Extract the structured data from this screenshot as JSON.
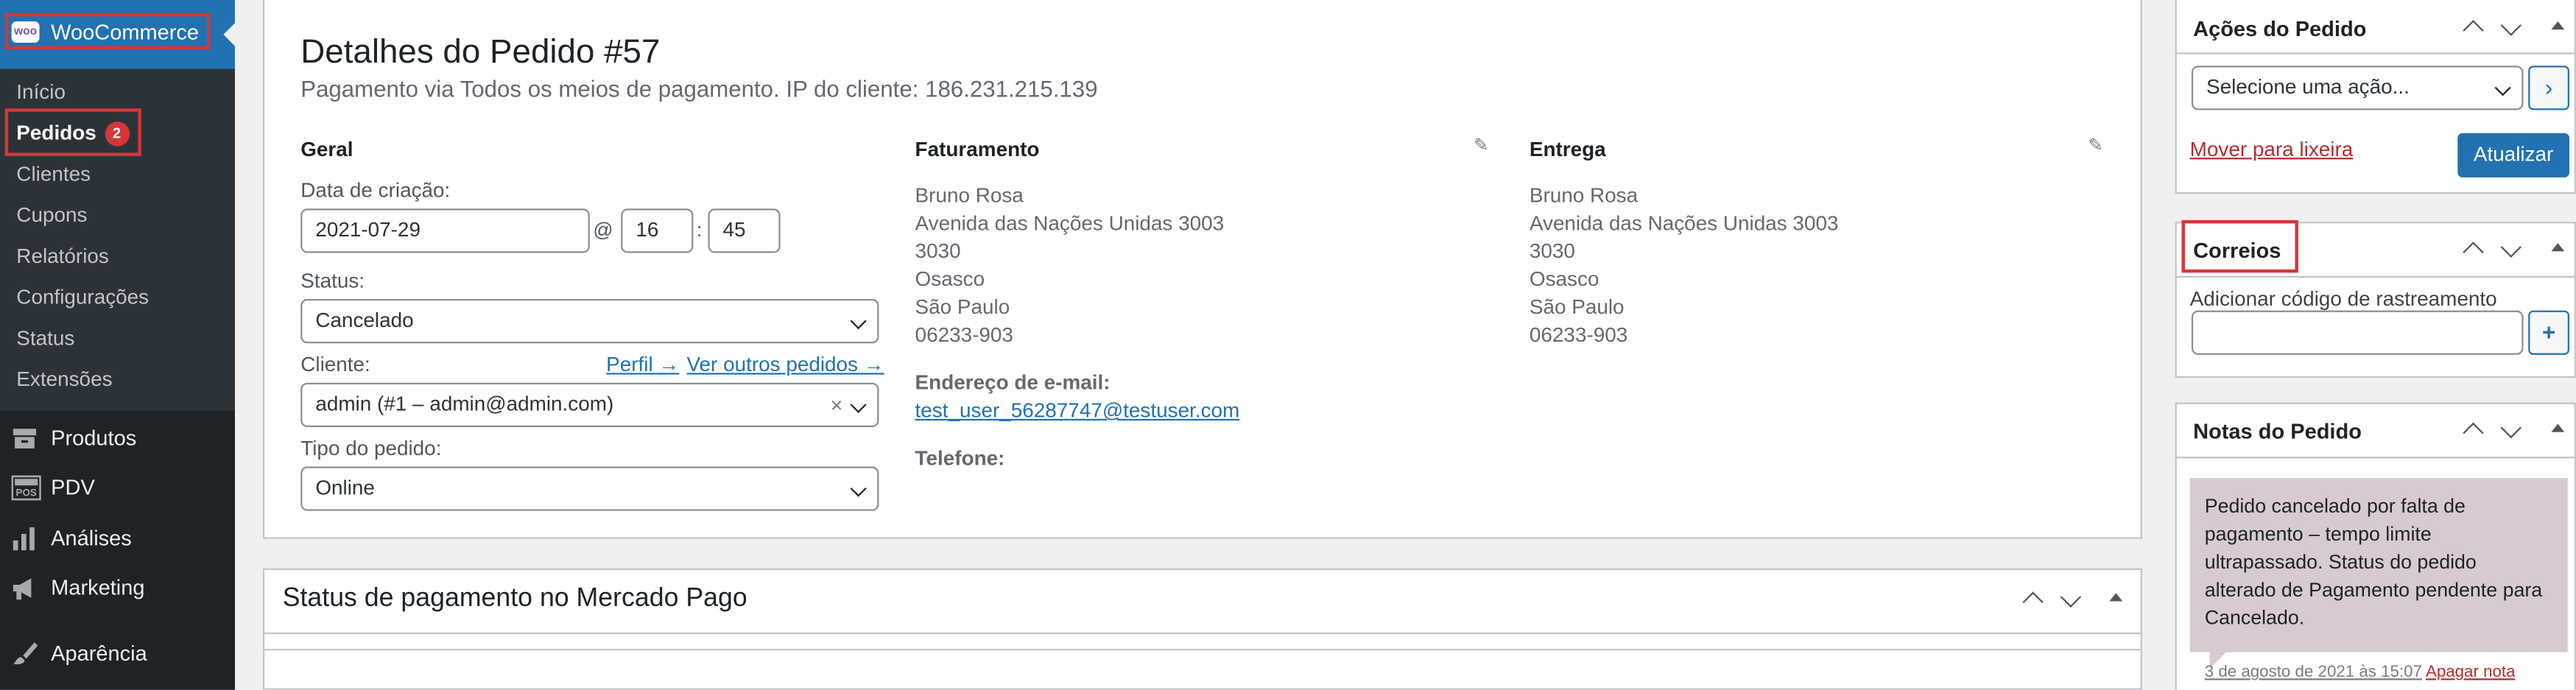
{
  "sidebar": {
    "brand": "WooCommerce",
    "logo_text": "woo",
    "submenu": [
      {
        "label": "Início"
      },
      {
        "label": "Pedidos",
        "badge": "2"
      },
      {
        "label": "Clientes"
      },
      {
        "label": "Cupons"
      },
      {
        "label": "Relatórios"
      },
      {
        "label": "Configurações"
      },
      {
        "label": "Status"
      },
      {
        "label": "Extensões"
      }
    ],
    "menu": [
      {
        "label": "Produtos",
        "icon": "archive-icon"
      },
      {
        "label": "PDV",
        "icon": "pos-icon"
      },
      {
        "label": "Análises",
        "icon": "bar-chart-icon"
      },
      {
        "label": "Marketing",
        "icon": "megaphone-icon"
      },
      {
        "label": "Aparência",
        "icon": "paintbrush-icon"
      }
    ]
  },
  "order": {
    "title": "Detalhes do Pedido #57",
    "subtitle": "Pagamento via Todos os meios de pagamento. IP do cliente: 186.231.215.139",
    "general": {
      "heading": "Geral",
      "date_label": "Data de criação:",
      "date": "2021-07-29",
      "at": "@",
      "hour": "16",
      "colon": ":",
      "minute": "45",
      "status_label": "Status:",
      "status": "Cancelado",
      "customer_label": "Cliente:",
      "profile_link": "Perfil →",
      "other_orders_link": "Ver outros pedidos →",
      "customer": "admin (#1 – admin@admin.com)",
      "clear": "×",
      "type_label": "Tipo do pedido:",
      "type": "Online"
    },
    "billing": {
      "heading": "Faturamento",
      "lines": [
        "Bruno Rosa",
        "Avenida das Nações Unidas 3003",
        "3030",
        "Osasco",
        "São Paulo",
        "06233-903"
      ],
      "email_label": "Endereço de e-mail:",
      "email": "test_user_56287747@testuser.com",
      "phone_label": "Telefone:"
    },
    "shipping": {
      "heading": "Entrega",
      "lines": [
        "Bruno Rosa",
        "Avenida das Nações Unidas 3003",
        "3030",
        "Osasco",
        "São Paulo",
        "06233-903"
      ]
    }
  },
  "mercado_pago": {
    "title": "Status de pagamento no Mercado Pago"
  },
  "actions_box": {
    "title": "Ações do Pedido",
    "select_placeholder": "Selecione uma ação...",
    "go": "›",
    "trash": "Mover para lixeira",
    "update": "Atualizar"
  },
  "correios_box": {
    "title": "Correios",
    "tracking_label": "Adicionar código de rastreamento",
    "add": "+"
  },
  "notes_box": {
    "title": "Notas do Pedido",
    "note_text": "Pedido cancelado por falta de pagamento – tempo limite ultrapassado. Status do pedido alterado de Pagamento pendente para Cancelado.",
    "note_date": "3 de agosto de 2021 às 15:07",
    "delete": "Apagar nota"
  },
  "colors": {
    "accent": "#2271b1",
    "danger": "#d63638",
    "sidebar": "#1d2327",
    "note_bg": "#d7cad2"
  }
}
